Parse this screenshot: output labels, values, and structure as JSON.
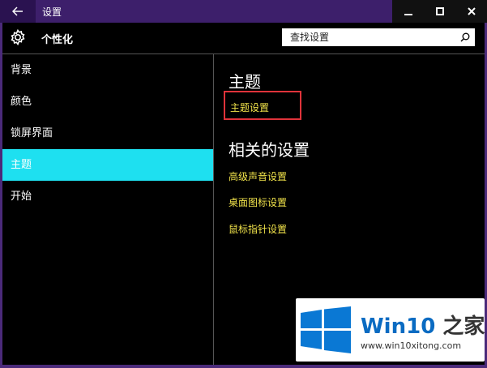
{
  "window": {
    "title": "设置",
    "back_icon": "back-arrow-icon",
    "controls": [
      "minimize-icon",
      "maximize-icon",
      "close-icon"
    ]
  },
  "header": {
    "icon": "gear-icon",
    "title": "个性化",
    "search": {
      "placeholder": "查找设置",
      "value": ""
    }
  },
  "sidebar": {
    "items": [
      {
        "label": "背景",
        "active": false
      },
      {
        "label": "颜色",
        "active": false
      },
      {
        "label": "锁屏界面",
        "active": false
      },
      {
        "label": "主题",
        "active": true
      },
      {
        "label": "开始",
        "active": false
      }
    ]
  },
  "main": {
    "theme_heading": "主题",
    "theme_settings_link": "主题设置",
    "related_heading": "相关的设置",
    "related_links": [
      "高级声音设置",
      "桌面图标设置",
      "鼠标指针设置"
    ]
  },
  "watermark": {
    "brand": "Win10",
    "brand_suffix": "之家",
    "url": "www.win10xitong.com"
  },
  "colors": {
    "accent_active": "#1ee0f0",
    "link": "#f0e24a",
    "highlight_box": "#e0333a",
    "title_bar": "#3d1f6b"
  }
}
